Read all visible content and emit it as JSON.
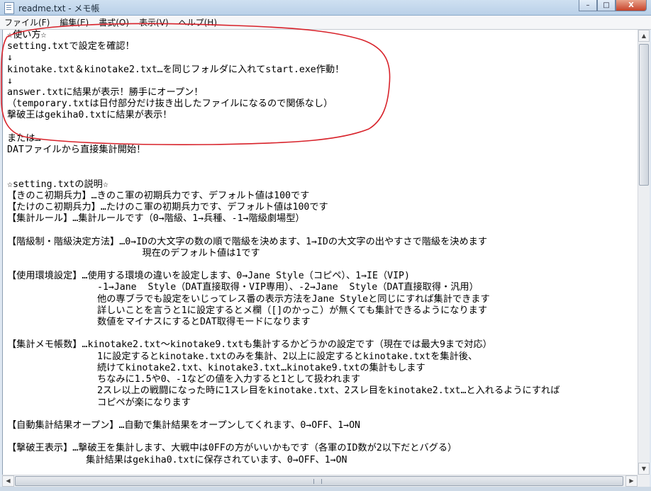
{
  "window": {
    "title": "readme.txt - メモ帳",
    "controls": {
      "minimize": "–",
      "maximize": "□",
      "close": "X"
    }
  },
  "menu": {
    "items": [
      {
        "label": "ファイル(F)"
      },
      {
        "label": "編集(E)"
      },
      {
        "label": "書式(O)"
      },
      {
        "label": "表示(V)"
      },
      {
        "label": "ヘルプ(H)"
      }
    ]
  },
  "document": {
    "lines": [
      "☆使い方☆",
      "setting.txtで設定を確認！",
      "↓",
      "kinotake.txt＆kinotake2.txt…を同じフォルダに入れてstart.exe作動！",
      "↓",
      "answer.txtに結果が表示！勝手にオープン！",
      "（temporary.txtは日付部分だけ抜き出したファイルになるので関係なし）",
      "撃破王はgekiha0.txtに結果が表示！",
      "",
      "または…",
      "DATファイルから直接集計開始！",
      "",
      "",
      "☆setting.txtの説明☆",
      "【きのこ初期兵力】…きのこ軍の初期兵力です、デフォルト値は100です",
      "【たけのこ初期兵力】…たけのこ軍の初期兵力です、デフォルト値は100です",
      "【集計ルール】…集計ルールです（0→階級、1→兵種、-1→階級劇場型）",
      "",
      "【階級制・階級決定方法】…0→IDの大文字の数の順で階級を決めます、1→IDの大文字の出やすさで階級を決めます",
      "                        現在のデフォルト値は1です",
      "",
      "【使用環境設定】…使用する環境の違いを設定します、0→Jane Style（コピペ）、1→IE（VIP)",
      "                -1→Jane  Style（DAT直接取得・VIP専用）、-2→Jane  Style（DAT直接取得・汎用）",
      "                他の専ブラでも設定をいじってレス番の表示方法をJane Styleと同じにすれば集計できます",
      "                詳しいことを言うと1に設定するとメ欄（[]のかっこ）が無くても集計できるようになります",
      "                数値をマイナスにするとDAT取得モードになります",
      "",
      "【集計メモ帳数】…kinotake2.txt～kinotake9.txtも集計するかどうかの設定です（現在では最大9まで対応）",
      "                1に設定するとkinotake.txtのみを集計、2以上に設定するとkinotake.txtを集計後、",
      "                続けてkinotake2.txt、kinotake3.txt…kinotake9.txtの集計もします",
      "                ちなみに1.5や0、-1などの値を入力すると1として扱われます",
      "                2スレ以上の戦闘になった時に1スレ目をkinotake.txt、2スレ目をkinotake2.txt…と入れるようにすれば",
      "                コピペが楽になります",
      "",
      "【自動集計結果オープン】…自動で集計結果をオープンしてくれます、0→OFF、1→ON",
      "",
      "【撃破王表示】…撃破王を集計します、大戦中は0FFの方がいいかもです（各軍のID数が2以下だとバグる）",
      "              集計結果はgekiha0.txtに保存されています、0→OFF、1→ON"
    ]
  },
  "colors": {
    "annotation": "#d8222a",
    "title_bar": "#c3d7ec",
    "close_button": "#c7432a"
  }
}
